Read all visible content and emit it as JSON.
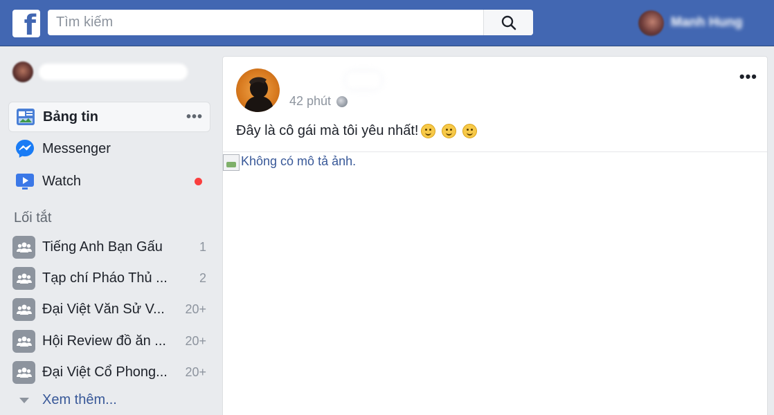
{
  "topbar": {
    "logo_glyph": "f",
    "search_placeholder": "Tìm kiếm",
    "user_name": "Manh Hung",
    "colors": {
      "brand": "#4267b2",
      "link": "#385898",
      "notification": "#fa3e3e"
    }
  },
  "sidebar": {
    "nav": [
      {
        "label": "Bảng tin",
        "icon": "news-feed-icon",
        "more": "•••"
      },
      {
        "label": "Messenger",
        "icon": "messenger-icon"
      },
      {
        "label": "Watch",
        "icon": "watch-icon"
      }
    ],
    "shortcuts_title": "Lối tắt",
    "shortcuts": [
      {
        "label": "Tiếng Anh Bạn Gấu",
        "count": "1"
      },
      {
        "label": "Tạp chí Pháo Thủ ...",
        "count": "2"
      },
      {
        "label": "Đại Việt Văn Sử V...",
        "count": "20+"
      },
      {
        "label": "Hội Review đồ ăn ...",
        "count": "20+"
      },
      {
        "label": "Đại Việt Cổ Phong...",
        "count": "20+"
      }
    ],
    "see_more": "Xem thêm..."
  },
  "post": {
    "time": "42 phút",
    "menu": "•••",
    "text": "Đây là cô gái mà tôi yêu nhất!",
    "image_alt": "Không có mô tả ảnh."
  }
}
